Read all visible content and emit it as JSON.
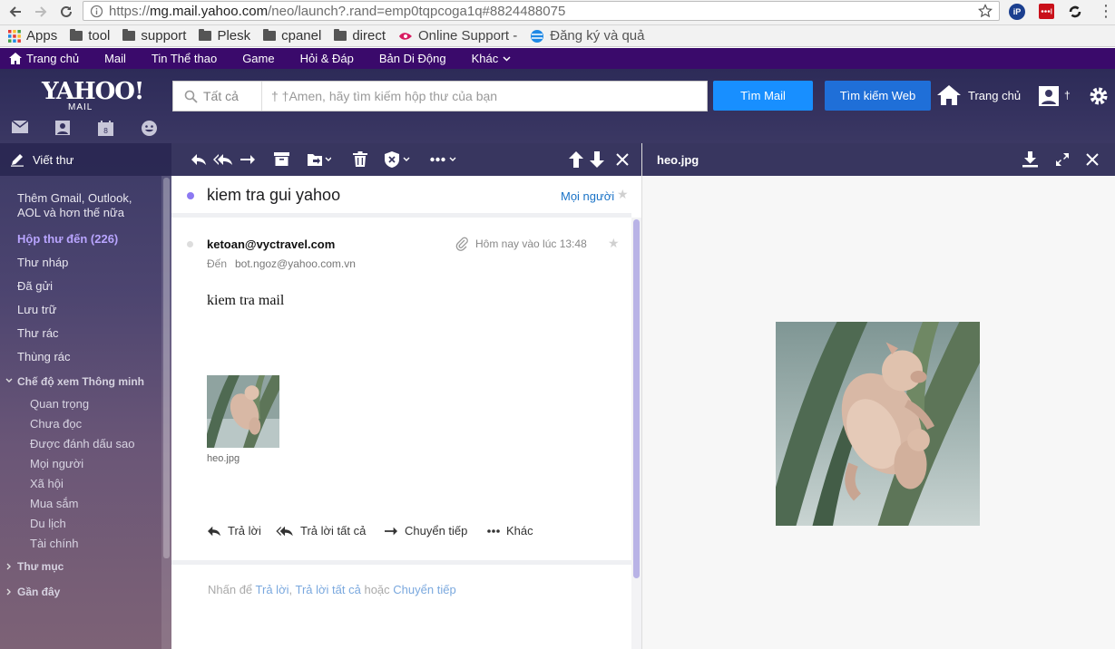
{
  "browser": {
    "url_prefix": "https://",
    "url_host": "mg.mail.yahoo.com",
    "url_path": "/neo/launch?.rand=emp0tqpcoga1q#8824488075"
  },
  "bookmarks": [
    {
      "label": "Apps",
      "icon": "apps-grid-icon"
    },
    {
      "label": "tool",
      "icon": "folder-icon"
    },
    {
      "label": "support",
      "icon": "folder-icon"
    },
    {
      "label": "Plesk",
      "icon": "folder-icon"
    },
    {
      "label": "cpanel",
      "icon": "folder-icon"
    },
    {
      "label": "direct",
      "icon": "folder-icon"
    },
    {
      "label": "Online Support -",
      "icon": "online-support-icon"
    },
    {
      "label": "Đăng ký và quả",
      "icon": "globe-icon"
    }
  ],
  "yahoo_nav": {
    "home": "Trang chủ",
    "mail": "Mail",
    "sports": "Tin Thể thao",
    "game": "Game",
    "answers": "Hỏi & Đáp",
    "maps": "Bản Di Động",
    "more": "Khác"
  },
  "header": {
    "logo": "YAHOO!",
    "logo_sub": "MAIL",
    "search_scope": "Tất cả",
    "search_placeholder": "† †Amen, hãy tìm kiếm hộp thư của bạn",
    "search_mail_button": "Tìm Mail",
    "search_web_button": "Tìm kiếm Web",
    "home_label": "Trang chủ",
    "user_name": "†"
  },
  "sidebar": {
    "compose": "Viết thư",
    "add_accounts_line1": "Thêm Gmail, Outlook,",
    "add_accounts_line2": "AOL và hơn thế nữa",
    "inbox": "Hộp thư đến (226)",
    "drafts": "Thư nháp",
    "sent": "Đã gửi",
    "archive": "Lưu trữ",
    "spam": "Thư rác",
    "trash": "Thùng rác",
    "smart_views": "Chế độ xem Thông minh",
    "smart_items": [
      "Quan trọng",
      "Chưa đọc",
      "Được đánh dấu sao",
      "Mọi người",
      "Xã hội",
      "Mua sắm",
      "Du lịch",
      "Tài chính"
    ],
    "folders": "Thư mục",
    "recent": "Gần đây"
  },
  "message": {
    "subject": "kiem tra gui yahoo",
    "people_link": "Mọi người",
    "sender": "ketoan@vyctravel.com",
    "to_label": "Đến",
    "to_address": "bot.ngoz@yahoo.com.vn",
    "time": "Hôm nay vào lúc 13:48",
    "body": "kiem tra mail",
    "attachment_name": "heo.jpg",
    "actions": {
      "reply": "Trả lời",
      "reply_all": "Trả lời tất cả",
      "forward": "Chuyển tiếp",
      "more": "Khác"
    },
    "hint_prefix": "Nhấn để",
    "hint_reply": "Trả lời",
    "hint_comma": ",",
    "hint_reply_all": "Trả lời tất cả",
    "hint_or": "hoặc",
    "hint_forward": "Chuyển tiếp"
  },
  "preview": {
    "title": "heo.jpg"
  },
  "colors": {
    "yahoo_purple": "#3a0a6b",
    "toolbar": "#38365f",
    "accent_blue": "#188fff",
    "inbox_highlight": "#b9a5ff",
    "link": "#1a73c7"
  }
}
